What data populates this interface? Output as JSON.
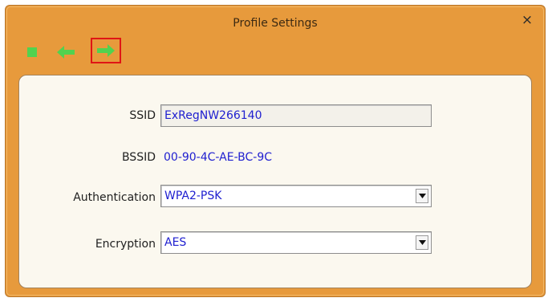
{
  "window": {
    "title": "Profile Settings",
    "close_label": "×"
  },
  "toolbar": {
    "items": [
      {
        "name": "stop-icon",
        "color": "#51d24f"
      },
      {
        "name": "arrow-left-icon",
        "color": "#51d24f"
      },
      {
        "name": "arrow-right-icon",
        "color": "#51d24f",
        "selected": true,
        "highlight_color": "#e01515"
      }
    ]
  },
  "form": {
    "ssid_label": "SSID",
    "ssid_value": "ExRegNW266140",
    "bssid_label": "BSSID",
    "bssid_value": "00-90-4C-AE-BC-9C",
    "authentication_label": "Authentication",
    "authentication_value": "WPA2-PSK",
    "encryption_label": "Encryption",
    "encryption_value": "AES"
  },
  "colors": {
    "window_bg": "#e79a3c",
    "panel_bg": "#fbf8ef",
    "value_text": "#2020d0"
  }
}
